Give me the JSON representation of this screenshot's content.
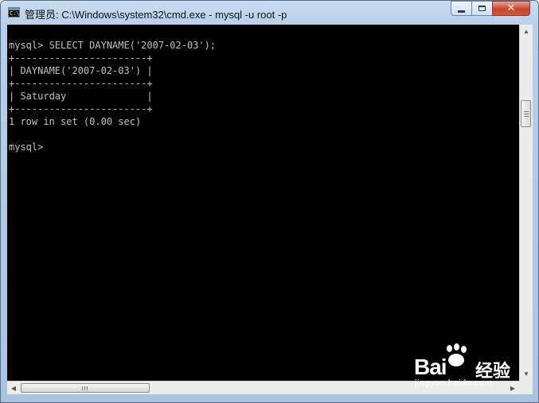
{
  "window": {
    "title": "管理员: C:\\Windows\\system32\\cmd.exe - mysql  -u root -p",
    "app_icon_text": "C:\\",
    "controls": {
      "minimize_icon": "minimize-icon",
      "maximize_icon": "maximize-icon",
      "close_glyph": "✕"
    }
  },
  "console": {
    "background": "#000000",
    "foreground": "#c0c0c0",
    "lines": [
      "mysql> SELECT DAYNAME('2007-02-03');",
      "+-----------------------+",
      "| DAYNAME('2007-02-03') |",
      "+-----------------------+",
      "| Saturday              |",
      "+-----------------------+",
      "1 row in set (0.00 sec)",
      "",
      "mysql>"
    ]
  },
  "scrollbars": {
    "up_arrow": "▲",
    "down_arrow": "▼",
    "left_arrow": "◀",
    "right_arrow": "▶"
  },
  "watermark": {
    "logo_text": "Bai",
    "logo_suffix_cn": "经验",
    "url": "jingyan.baidu.com"
  }
}
